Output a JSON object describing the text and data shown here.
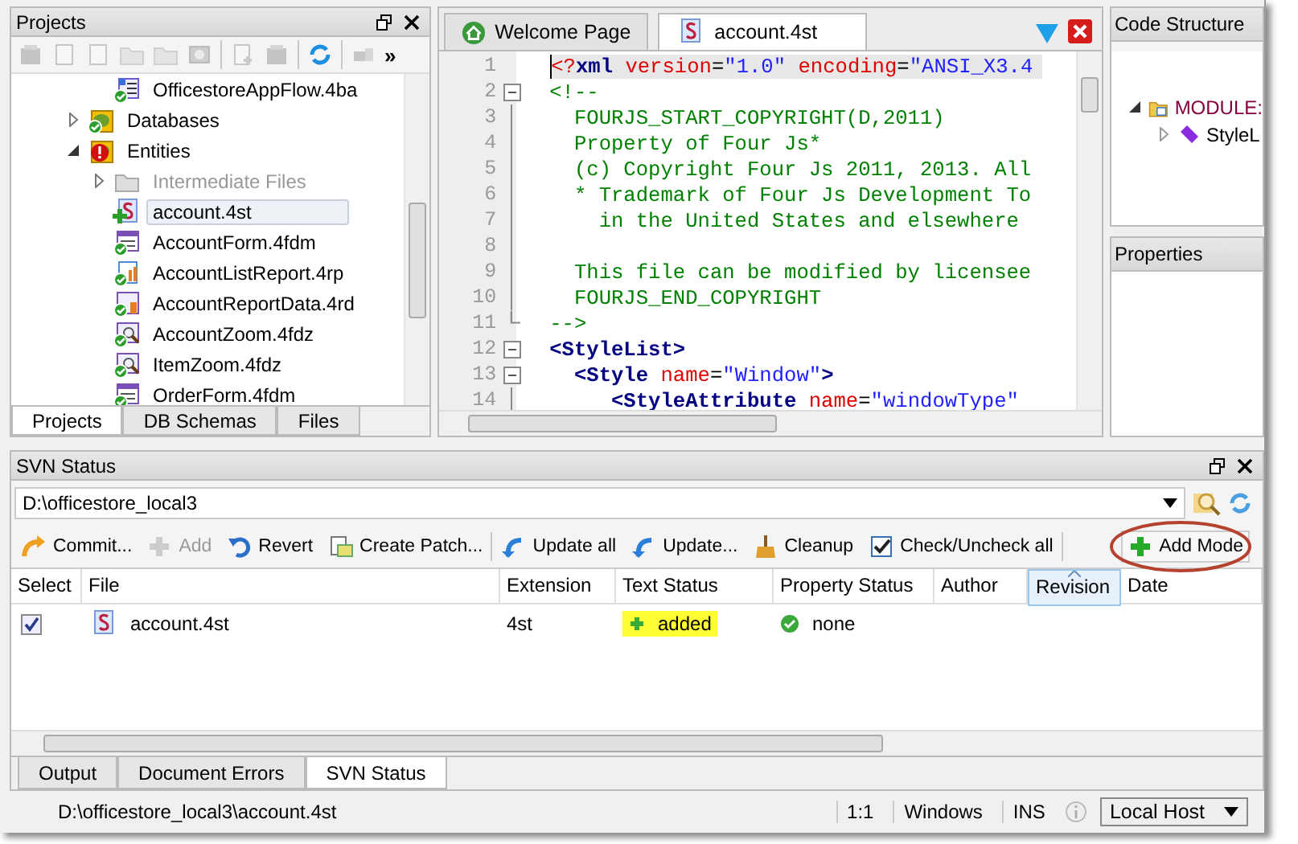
{
  "projects_panel": {
    "title": "Projects",
    "toolbar": [
      [
        {
          "kind": "box",
          "disabled": true
        },
        {
          "kind": "doc",
          "disabled": true
        },
        {
          "kind": "doc",
          "disabled": true
        },
        {
          "kind": "folder",
          "disabled": true
        },
        {
          "kind": "folder",
          "disabled": true
        },
        {
          "kind": "gearbox",
          "disabled": true
        }
      ],
      [
        {
          "kind": "docplus",
          "disabled": true
        },
        {
          "kind": "box",
          "disabled": true
        }
      ],
      [
        {
          "kind": "refresh",
          "disabled": false
        }
      ],
      [
        {
          "kind": "plug",
          "disabled": true
        }
      ]
    ],
    "overflow": "»",
    "tree": {
      "continued": [
        {
          "label": "OfficestoreAppFlow.4ba",
          "kind": "flow-ok",
          "selected": false,
          "disabled": false
        }
      ],
      "items": [
        {
          "label": "Databases",
          "kind": "database-ok",
          "expanded": false,
          "selected": false,
          "disabled": false
        },
        {
          "label": "Entities",
          "kind": "database-error",
          "expanded": true,
          "selected": false,
          "disabled": false,
          "children": [
            {
              "label": "Intermediate Files",
              "kind": "folder",
              "expanded": false,
              "selected": false,
              "disabled": true
            },
            {
              "label": "account.4st",
              "kind": "style-added",
              "selected": true,
              "disabled": false
            },
            {
              "label": "AccountForm.4fdm",
              "kind": "form-ok",
              "selected": false,
              "disabled": false
            },
            {
              "label": "AccountListReport.4rp",
              "kind": "report-ok",
              "selected": false,
              "disabled": false
            },
            {
              "label": "AccountReportData.4rd",
              "kind": "reportdata-ok",
              "selected": false,
              "disabled": false
            },
            {
              "label": "AccountZoom.4fdz",
              "kind": "zoom-ok",
              "selected": false,
              "disabled": false
            },
            {
              "label": "ItemZoom.4fdz",
              "kind": "zoom-ok",
              "selected": false,
              "disabled": false
            },
            {
              "label": "OrderForm.4fdm",
              "kind": "form-ok",
              "selected": false,
              "disabled": false
            }
          ]
        }
      ]
    },
    "tabs": [
      {
        "label": "Projects",
        "selected": true
      },
      {
        "label": "DB Schemas",
        "selected": false
      },
      {
        "label": "Files",
        "selected": false
      }
    ]
  },
  "editor": {
    "tabs": [
      {
        "label": "Welcome Page",
        "kind": "home",
        "selected": false
      },
      {
        "label": "account.4st",
        "kind": "style",
        "selected": true
      }
    ],
    "lines": [
      {
        "number": "1",
        "current": true,
        "kind": "plain",
        "tokens": [
          {
            "kind": "pi",
            "text": "<?"
          },
          {
            "kind": "keyword",
            "text": "xml"
          },
          {
            "kind": "attr",
            "text": " version"
          },
          {
            "kind": "punct",
            "text": "="
          },
          {
            "kind": "value",
            "text": "\"1.0\""
          },
          {
            "kind": "attr",
            "text": " encoding"
          },
          {
            "kind": "punct",
            "text": "="
          },
          {
            "kind": "value",
            "text": "\"ANSI_X3.4"
          }
        ]
      },
      {
        "number": "2",
        "current": false,
        "kind": "fold-start",
        "tokens": [
          {
            "kind": "comment",
            "text": "<!--"
          }
        ]
      },
      {
        "number": "3",
        "current": false,
        "kind": "fold-inner",
        "tokens": [
          {
            "kind": "comment",
            "text": "  FOURJS_START_COPYRIGHT(D,2011)"
          }
        ]
      },
      {
        "number": "4",
        "current": false,
        "kind": "fold-inner",
        "tokens": [
          {
            "kind": "comment",
            "text": "  Property of Four Js*"
          }
        ]
      },
      {
        "number": "5",
        "current": false,
        "kind": "fold-inner",
        "tokens": [
          {
            "kind": "comment",
            "text": "  (c) Copyright Four Js 2011, 2013. All"
          }
        ]
      },
      {
        "number": "6",
        "current": false,
        "kind": "fold-inner",
        "tokens": [
          {
            "kind": "comment",
            "text": "  * Trademark of Four Js Development To"
          }
        ]
      },
      {
        "number": "7",
        "current": false,
        "kind": "fold-inner",
        "tokens": [
          {
            "kind": "comment",
            "text": "    in the United States and elsewhere"
          }
        ]
      },
      {
        "number": "8",
        "current": false,
        "kind": "fold-inner"
      },
      {
        "number": "9",
        "current": false,
        "kind": "fold-inner",
        "tokens": [
          {
            "kind": "comment",
            "text": "  This file can be modified by licensee"
          }
        ]
      },
      {
        "number": "10",
        "current": false,
        "kind": "fold-inner",
        "tokens": [
          {
            "kind": "comment",
            "text": "  FOURJS_END_COPYRIGHT"
          }
        ]
      },
      {
        "number": "11",
        "current": false,
        "kind": "fold-end",
        "tokens": [
          {
            "kind": "comment",
            "text": "-->"
          }
        ]
      },
      {
        "number": "12",
        "current": false,
        "kind": "fold-start",
        "tokens": [
          {
            "kind": "keyword",
            "text": "<StyleList>"
          }
        ]
      },
      {
        "number": "13",
        "current": false,
        "kind": "fold-start",
        "tokens": [
          {
            "kind": "keyword",
            "text": "  <Style"
          },
          {
            "kind": "attr",
            "text": " name"
          },
          {
            "kind": "punct",
            "text": "="
          },
          {
            "kind": "value",
            "text": "\"Window\""
          },
          {
            "kind": "keyword",
            "text": ">"
          }
        ]
      },
      {
        "number": "14",
        "current": false,
        "kind": "fold-inner",
        "tokens": [
          {
            "kind": "keyword",
            "text": "     <StyleAttribute"
          },
          {
            "kind": "attr",
            "text": " name"
          },
          {
            "kind": "punct",
            "text": "="
          },
          {
            "kind": "value",
            "text": "\"windowType\""
          }
        ]
      }
    ]
  },
  "code_structure": {
    "title": "Code Structure",
    "items": [
      {
        "label": "MODULE:",
        "kind": "module",
        "expanded": true,
        "children": [
          {
            "label": "StyleL",
            "kind": "element",
            "expanded": false
          }
        ]
      }
    ]
  },
  "properties": {
    "title": "Properties"
  },
  "svn_panel": {
    "title": "SVN Status",
    "path": "D:\\officestore_local3",
    "toolbar": [
      [
        {
          "label": "Commit...",
          "kind": "commit",
          "disabled": false,
          "circled": false
        },
        {
          "label": "Add",
          "kind": "plus",
          "disabled": true,
          "circled": false
        },
        {
          "label": "Revert",
          "kind": "revert",
          "disabled": false,
          "circled": false
        },
        {
          "label": "Create Patch...",
          "kind": "patch",
          "disabled": false,
          "circled": false
        }
      ],
      [
        {
          "label": "Update all",
          "kind": "update",
          "disabled": false,
          "circled": false
        },
        {
          "label": "Update...",
          "kind": "update",
          "disabled": false,
          "circled": false
        },
        {
          "label": "Cleanup",
          "kind": "broom",
          "disabled": false,
          "circled": false
        },
        {
          "label": "Check/Uncheck all",
          "kind": "checklist",
          "disabled": false,
          "circled": false
        }
      ],
      [
        {
          "label": "Add Mode",
          "kind": "plus",
          "disabled": false,
          "circled": true
        }
      ]
    ],
    "columns": [
      {
        "label": "Select",
        "sorted": false
      },
      {
        "label": "File",
        "sorted": false
      },
      {
        "label": "Extension",
        "sorted": false
      },
      {
        "label": "Text Status",
        "sorted": false
      },
      {
        "label": "Property Status",
        "sorted": false
      },
      {
        "label": "Author",
        "sorted": false
      },
      {
        "label": "Revision",
        "sorted": true
      },
      {
        "label": "Date",
        "sorted": false
      }
    ],
    "rows": [
      {
        "checked": true,
        "file": "account.4st",
        "extension": "4st",
        "text_status": "added",
        "text_status_highlighted": true,
        "property_status": "none"
      }
    ],
    "tabs": [
      {
        "label": "Output",
        "selected": false
      },
      {
        "label": "Document Errors",
        "selected": false
      },
      {
        "label": "SVN Status",
        "selected": true
      }
    ]
  },
  "status_bar": {
    "path": "D:\\officestore_local3\\account.4st",
    "position": "1:1",
    "line_endings": "Windows",
    "mode": "INS",
    "host": "Local Host"
  }
}
